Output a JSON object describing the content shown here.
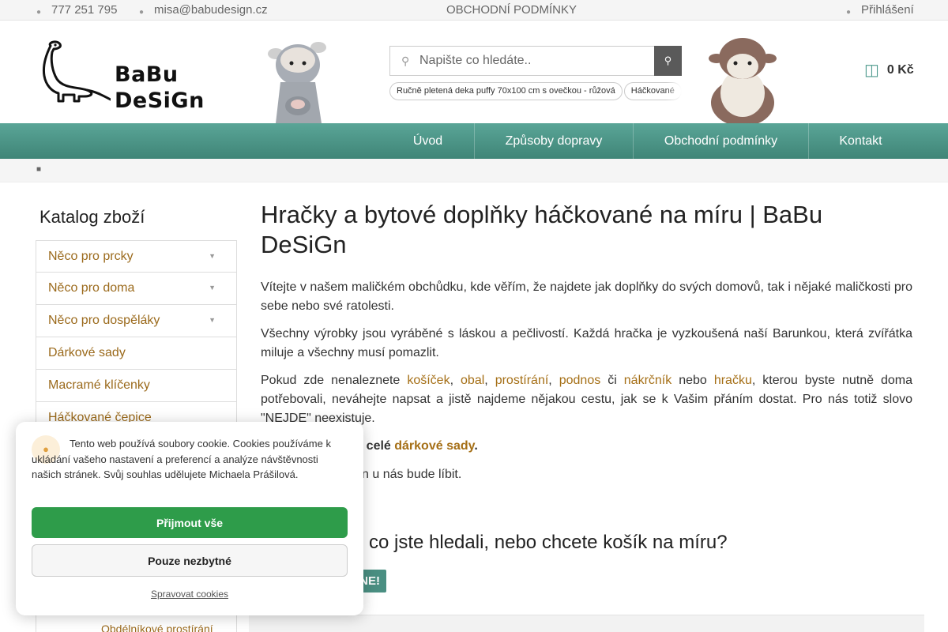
{
  "topbar": {
    "phone": "777 251 795",
    "email": "misa@babudesign.cz",
    "terms": "OBCHODNÍ PODMÍNKY",
    "login": "Přihlášení"
  },
  "header": {
    "logo_line1": "BaBu",
    "logo_line2": "DeSiGn",
    "search_placeholder": "Napište co hledáte..",
    "tags": [
      "Ručně pletená deka puffy 70x100 cm s ovečkou - růžová",
      "Háčkované"
    ],
    "cart_value": "0 Kč"
  },
  "nav": {
    "items": [
      "Úvod",
      "Způsoby dopravy",
      "Obchodní podmínky",
      "Kontakt"
    ]
  },
  "sidebar": {
    "title": "Katalog zboží",
    "items": [
      {
        "label": "Něco pro prcky",
        "has_children": true
      },
      {
        "label": "Něco pro doma",
        "has_children": true
      },
      {
        "label": "Něco pro dospěláky",
        "has_children": true
      },
      {
        "label": "Dárkové sady",
        "has_children": false
      },
      {
        "label": "Macramé klíčenky",
        "has_children": false
      },
      {
        "label": "Háčkované čepice",
        "has_children": false
      }
    ],
    "sub_item": "Obdélníkové prostírání"
  },
  "main": {
    "title": "Hračky a bytové doplňky háčkované na míru | BaBu DeSiGn",
    "p1": "Vítejte v našem maličkém obchůdku, kde věřím, že najdete jak doplňky do svých domovů, tak i nějaké maličkosti pro sebe nebo své ratolesti.",
    "p2": "Všechny výrobky jsou vyráběné s láskou a pečlivostí. Každá hračka je vyzkoušená naší Barunkou, která zvířátka miluje a všechny musí pomazlit.",
    "p3": {
      "start": "Pokud zde nenaleznete ",
      "l1": "košíček",
      "sep1": ", ",
      "l2": "obal",
      "sep2": ", ",
      "l3": "prostírání",
      "sep3": ", ",
      "l4": "podnos",
      "sep4": " či ",
      "l5": "nákrčník",
      "sep5": " nebo ",
      "l6": "hračku",
      "end": ", kterou byste nutně doma potřebovali, neváhejte napsat a jistě najdeme nějakou cestu, jak se k Vašim přáním dostat. Pro nás totiž slovo \"NEJDE\" neexistuje."
    },
    "p4_visible": "t i celé ",
    "p4_link": "dárkové sady",
    "p4_end": ".",
    "p5_visible": "n u nás bude líbit.",
    "h2_visible": "co jste hledali, nebo chcete košík na míru?",
    "cta_visible": "NE!"
  },
  "cookie": {
    "text": "Tento web používá soubory cookie. Cookies používáme k ukládání vašeho nastavení a preferencí a analýze návštěvnosti našich stránek. Svůj souhlas udělujete Michaela Prášilová.",
    "accept": "Přijmout vše",
    "necessary": "Pouze nezbytné",
    "manage": "Spravovat cookies"
  },
  "colors": {
    "accent": "#4f9a8e",
    "link": "#a56f16",
    "accept_button": "#2e9c4a"
  },
  "icons": {
    "phone": "phone-icon",
    "email": "envelope-icon",
    "login": "user-icon",
    "search": "search-icon",
    "cart": "cart-icon",
    "home": "home-icon",
    "chevron": "chevron-down-icon",
    "cookie": "cookie-icon"
  }
}
